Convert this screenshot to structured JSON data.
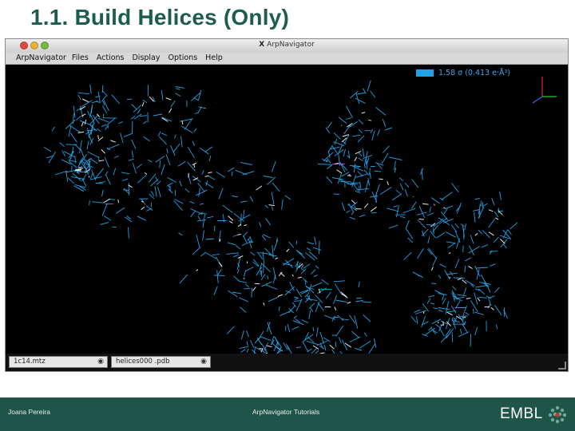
{
  "slide": {
    "title": "1.1. Build Helices (Only)",
    "footer": {
      "author": "Joana Pereira",
      "center": "ArpNavigator Tutorials",
      "logo": "EMBL"
    },
    "theme": {
      "accent": "#1e5548",
      "title_color": "#1e5c4f"
    }
  },
  "window": {
    "title": "ArpNavigator",
    "title_icon": "x11-icon",
    "menu": [
      "ArpNavigator",
      "Files",
      "Actions",
      "Display",
      "Options",
      "Help"
    ]
  },
  "viewer": {
    "background": "#000000",
    "map_color": "#1fa3e6",
    "contour_label": "1.58 σ (0.413 e·Å³)",
    "axes_icon": "xyz-axes-icon"
  },
  "files": [
    {
      "name": "1c14.mtz",
      "icon": "eye-icon"
    },
    {
      "name": "helices000 .pdb",
      "icon": "eye-icon"
    }
  ]
}
